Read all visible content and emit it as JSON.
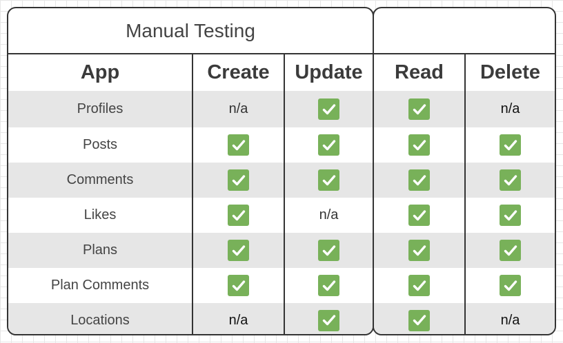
{
  "title": "Manual Testing",
  "headers": {
    "app": "App",
    "create": "Create",
    "update": "Update",
    "read": "Read",
    "delete": "Delete"
  },
  "na_label": "n/a",
  "check_color": "#78b159",
  "check_icon": "white-heavy-check-mark",
  "row_shading": [
    "#e6e6e6",
    "#ffffff"
  ],
  "rows": [
    {
      "app": "Profiles",
      "create": "n/a",
      "update": "check",
      "read": "check",
      "delete": "n/a"
    },
    {
      "app": "Posts",
      "create": "check",
      "update": "check",
      "read": "check",
      "delete": "check"
    },
    {
      "app": "Comments",
      "create": "check",
      "update": "check",
      "read": "check",
      "delete": "check"
    },
    {
      "app": "Likes",
      "create": "check",
      "update": "n/a",
      "read": "check",
      "delete": "check"
    },
    {
      "app": "Plans",
      "create": "check",
      "update": "check",
      "read": "check",
      "delete": "check"
    },
    {
      "app": "Plan Comments",
      "create": "check",
      "update": "check",
      "read": "check",
      "delete": "check"
    },
    {
      "app": "Locations",
      "create": "n/a",
      "update": "check",
      "read": "check",
      "delete": "n/a"
    }
  ]
}
